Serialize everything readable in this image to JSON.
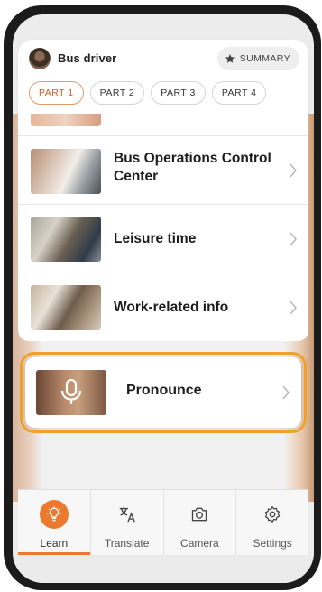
{
  "header": {
    "title": "Bus driver",
    "summary_label": "SUMMARY"
  },
  "parts": [
    {
      "label": "PART 1",
      "active": true
    },
    {
      "label": "PART 2",
      "active": false
    },
    {
      "label": "PART 3",
      "active": false
    },
    {
      "label": "PART 4",
      "active": false
    }
  ],
  "list": {
    "items": [
      {
        "label_line1": "Bus Operations Control",
        "label_line2": "Center"
      },
      {
        "label": "Leisure time"
      },
      {
        "label": "Work-related info"
      }
    ]
  },
  "pronounce": {
    "label": "Pronounce",
    "highlight_color": "#F0A12A"
  },
  "nav": {
    "items": [
      {
        "label": "Learn",
        "icon": "lightbulb-icon",
        "active": true
      },
      {
        "label": "Translate",
        "icon": "translate-icon",
        "active": false
      },
      {
        "label": "Camera",
        "icon": "camera-icon",
        "active": false
      },
      {
        "label": "Settings",
        "icon": "gear-icon",
        "active": false
      }
    ]
  },
  "colors": {
    "accent": "#EC7A2E",
    "active_part_border": "#E39A6A"
  }
}
